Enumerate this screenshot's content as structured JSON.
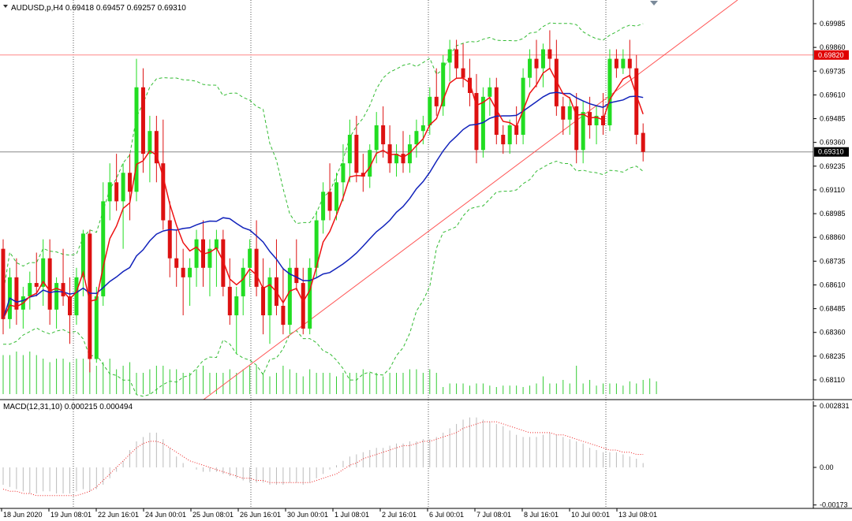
{
  "header": {
    "symbol_line": "AUDUSD,p,H4  0.69418 0.69457 0.69257 0.69310",
    "macd_line": "MACD(12,31,10) 0.000215 0.000494"
  },
  "colors": {
    "bull": "#22dd22",
    "bear": "#dd1111",
    "ma_fast": "#ee1111",
    "ma_slow": "#1122bb",
    "bollinger": "#33bb33",
    "trendline": "#ff5555",
    "resistance_line": "#ff8888",
    "support_line": "#888888",
    "grid_vertical": "#555555",
    "volume": "#33cc33",
    "macd_hist": "#bbbbbb",
    "macd_signal": "#ee2222",
    "label_red_bg": "#e00000",
    "label_black_bg": "#000000"
  },
  "price_axis": {
    "ticks": [
      "0.69985",
      "0.69860",
      "0.69735",
      "0.69610",
      "0.69485",
      "0.69360",
      "0.69235",
      "0.69110",
      "0.68985",
      "0.68860",
      "0.68735",
      "0.68610",
      "0.68485",
      "0.68360",
      "0.68235",
      "0.68110"
    ],
    "range": [
      0.6807,
      0.7002
    ]
  },
  "time_axis": {
    "ticks": [
      "18 Jun 2020",
      "19 Jun 08:01",
      "22 Jun 16:01",
      "24 Jun 00:01",
      "25 Jun 08:01",
      "26 Jun 16:01",
      "30 Jun 00:01",
      "1 Jul 08:01",
      "2 Jul 16:01",
      "6 Jul 00:01",
      "7 Jul 08:01",
      "8 Jul 16:01",
      "10 Jul 00:01",
      "13 Jul 08:01"
    ]
  },
  "horizontal_lines": {
    "resistance": "0.69820",
    "current": "0.69310"
  },
  "macd_axis": {
    "ticks": [
      "0.002831",
      "0.00",
      "-0.00173"
    ],
    "range": [
      -0.00173,
      0.002831
    ]
  },
  "chart_data": {
    "type": "candlestick",
    "symbol": "AUDUSD,p",
    "timeframe": "H4",
    "candles": [
      [
        0.688,
        0.6885,
        0.6835,
        0.6843
      ],
      [
        0.6843,
        0.687,
        0.6838,
        0.6865
      ],
      [
        0.6865,
        0.6875,
        0.684,
        0.6848
      ],
      [
        0.6848,
        0.686,
        0.6838,
        0.6855
      ],
      [
        0.6855,
        0.6868,
        0.6848,
        0.6862
      ],
      [
        0.6862,
        0.6878,
        0.6855,
        0.686
      ],
      [
        0.686,
        0.6885,
        0.685,
        0.6875
      ],
      [
        0.6875,
        0.6885,
        0.684,
        0.6848
      ],
      [
        0.6848,
        0.6865,
        0.6838,
        0.6862
      ],
      [
        0.6862,
        0.688,
        0.685,
        0.6855
      ],
      [
        0.6855,
        0.6865,
        0.683,
        0.6845
      ],
      [
        0.6845,
        0.687,
        0.684,
        0.6865
      ],
      [
        0.6865,
        0.689,
        0.6855,
        0.6888
      ],
      [
        0.6888,
        0.689,
        0.6815,
        0.6822
      ],
      [
        0.6822,
        0.686,
        0.682,
        0.6855
      ],
      [
        0.6855,
        0.6915,
        0.685,
        0.6905
      ],
      [
        0.6905,
        0.6925,
        0.6895,
        0.6915
      ],
      [
        0.6915,
        0.693,
        0.69,
        0.6905
      ],
      [
        0.6905,
        0.6925,
        0.688,
        0.692
      ],
      [
        0.692,
        0.693,
        0.6895,
        0.691
      ],
      [
        0.691,
        0.698,
        0.6905,
        0.6965
      ],
      [
        0.6965,
        0.6975,
        0.692,
        0.693
      ],
      [
        0.693,
        0.695,
        0.6915,
        0.6942
      ],
      [
        0.6942,
        0.695,
        0.6915,
        0.6925
      ],
      [
        0.6925,
        0.6948,
        0.689,
        0.6895
      ],
      [
        0.6895,
        0.6905,
        0.6865,
        0.6875
      ],
      [
        0.6875,
        0.689,
        0.686,
        0.687
      ],
      [
        0.687,
        0.688,
        0.6845,
        0.6865
      ],
      [
        0.6865,
        0.6875,
        0.685,
        0.687
      ],
      [
        0.687,
        0.689,
        0.686,
        0.6885
      ],
      [
        0.6885,
        0.6895,
        0.686,
        0.687
      ],
      [
        0.687,
        0.6885,
        0.6855,
        0.688
      ],
      [
        0.688,
        0.689,
        0.686,
        0.6885
      ],
      [
        0.6885,
        0.689,
        0.6855,
        0.686
      ],
      [
        0.686,
        0.6875,
        0.684,
        0.6845
      ],
      [
        0.6845,
        0.686,
        0.6825,
        0.6855
      ],
      [
        0.6855,
        0.6875,
        0.6845,
        0.687
      ],
      [
        0.687,
        0.6885,
        0.686,
        0.688
      ],
      [
        0.688,
        0.6895,
        0.6855,
        0.686
      ],
      [
        0.686,
        0.6875,
        0.6835,
        0.6845
      ],
      [
        0.6845,
        0.687,
        0.683,
        0.6865
      ],
      [
        0.6865,
        0.6885,
        0.6845,
        0.685
      ],
      [
        0.685,
        0.687,
        0.6835,
        0.684
      ],
      [
        0.684,
        0.6875,
        0.6835,
        0.687
      ],
      [
        0.687,
        0.6885,
        0.6858,
        0.6862
      ],
      [
        0.6862,
        0.687,
        0.6835,
        0.6838
      ],
      [
        0.6838,
        0.6875,
        0.6835,
        0.687
      ],
      [
        0.687,
        0.69,
        0.6865,
        0.6895
      ],
      [
        0.6895,
        0.6915,
        0.6888,
        0.691
      ],
      [
        0.691,
        0.6925,
        0.6895,
        0.69
      ],
      [
        0.69,
        0.692,
        0.6895,
        0.6915
      ],
      [
        0.6915,
        0.6935,
        0.6905,
        0.6925
      ],
      [
        0.6925,
        0.6948,
        0.6915,
        0.694
      ],
      [
        0.694,
        0.695,
        0.6915,
        0.692
      ],
      [
        0.692,
        0.693,
        0.691,
        0.6918
      ],
      [
        0.6918,
        0.6935,
        0.6912,
        0.6932
      ],
      [
        0.6932,
        0.6952,
        0.6925,
        0.6945
      ],
      [
        0.6945,
        0.6955,
        0.6928,
        0.6935
      ],
      [
        0.6935,
        0.6945,
        0.692,
        0.6925
      ],
      [
        0.6925,
        0.6935,
        0.6918,
        0.693
      ],
      [
        0.693,
        0.6942,
        0.692,
        0.6925
      ],
      [
        0.6925,
        0.694,
        0.692,
        0.6935
      ],
      [
        0.6935,
        0.6948,
        0.6928,
        0.6942
      ],
      [
        0.6942,
        0.695,
        0.6935,
        0.6945
      ],
      [
        0.6945,
        0.6965,
        0.694,
        0.696
      ],
      [
        0.696,
        0.6975,
        0.695,
        0.6955
      ],
      [
        0.6955,
        0.6982,
        0.695,
        0.6978
      ],
      [
        0.6978,
        0.699,
        0.6968,
        0.6985
      ],
      [
        0.6985,
        0.699,
        0.697,
        0.6975
      ],
      [
        0.6975,
        0.6988,
        0.6965,
        0.697
      ],
      [
        0.697,
        0.698,
        0.6955,
        0.6962
      ],
      [
        0.6962,
        0.6972,
        0.6925,
        0.6932
      ],
      [
        0.6932,
        0.6965,
        0.6928,
        0.696
      ],
      [
        0.696,
        0.697,
        0.695,
        0.6965
      ],
      [
        0.6965,
        0.697,
        0.6935,
        0.694
      ],
      [
        0.694,
        0.6945,
        0.693,
        0.6935
      ],
      [
        0.6935,
        0.6948,
        0.693,
        0.6945
      ],
      [
        0.6945,
        0.6955,
        0.6935,
        0.694
      ],
      [
        0.694,
        0.6975,
        0.6935,
        0.697
      ],
      [
        0.697,
        0.6985,
        0.6965,
        0.698
      ],
      [
        0.698,
        0.699,
        0.6965,
        0.6975
      ],
      [
        0.6975,
        0.6988,
        0.6965,
        0.6985
      ],
      [
        0.6985,
        0.6995,
        0.6975,
        0.698
      ],
      [
        0.698,
        0.699,
        0.695,
        0.6955
      ],
      [
        0.6955,
        0.696,
        0.694,
        0.6948
      ],
      [
        0.6948,
        0.696,
        0.694,
        0.6955
      ],
      [
        0.6955,
        0.6962,
        0.6925,
        0.6932
      ],
      [
        0.6932,
        0.6958,
        0.6925,
        0.6952
      ],
      [
        0.6952,
        0.696,
        0.6938,
        0.6945
      ],
      [
        0.6945,
        0.6955,
        0.6935,
        0.695
      ],
      [
        0.695,
        0.6962,
        0.694,
        0.6945
      ],
      [
        0.6945,
        0.6985,
        0.6942,
        0.698
      ],
      [
        0.698,
        0.6985,
        0.697,
        0.6975
      ],
      [
        0.6975,
        0.6985,
        0.6972,
        0.698
      ],
      [
        0.698,
        0.699,
        0.697,
        0.6975
      ],
      [
        0.6975,
        0.6982,
        0.6935,
        0.694
      ],
      [
        0.6941,
        0.6946,
        0.6926,
        0.6931
      ]
    ],
    "volume": [
      0.55,
      0.55,
      0.6,
      0.55,
      0.6,
      0.55,
      0.5,
      0.45,
      0.5,
      0.5,
      0.45,
      0.5,
      0.5,
      0.45,
      0.4,
      0.45,
      0.5,
      0.35,
      0.4,
      0.45,
      0.3,
      0.3,
      0.35,
      0.4,
      0.4,
      0.35,
      0.35,
      0.3,
      0.3,
      0.35,
      0.4,
      0.3,
      0.3,
      0.3,
      0.35,
      0.3,
      0.35,
      0.4,
      0.4,
      0.3,
      0.25,
      0.3,
      0.4,
      0.35,
      0.3,
      0.25,
      0.35,
      0.3,
      0.3,
      0.3,
      0.25,
      0.3,
      0.3,
      0.3,
      0.35,
      0.3,
      0.3,
      0.25,
      0.3,
      0.3,
      0.3,
      0.35,
      0.35,
      0.3,
      0.35,
      0.3,
      0.1,
      0.15,
      0.15,
      0.15,
      0.12,
      0.15,
      0.15,
      0.12,
      0.1,
      0.12,
      0.12,
      0.12,
      0.1,
      0.12,
      0.15,
      0.25,
      0.15,
      0.15,
      0.2,
      0.15,
      0.4,
      0.15,
      0.2,
      0.12,
      0.15,
      0.15,
      0.15,
      0.12,
      0.18,
      0.15,
      0.2,
      0.22,
      0.18
    ],
    "macd_hist": [
      -0.0008,
      -0.0009,
      -0.001,
      -0.0011,
      -0.0012,
      -0.0012,
      -0.0011,
      -0.0011,
      -0.0012,
      -0.0012,
      -0.0012,
      -0.0011,
      -0.001,
      -0.0011,
      -0.001,
      -0.0008,
      -0.0005,
      -0.0002,
      0.0003,
      0.0008,
      0.0012,
      0.0014,
      0.0016,
      0.0016,
      0.0013,
      0.0009,
      0.0005,
      0.0002,
      0.0,
      -0.0001,
      -0.0002,
      -0.0002,
      -0.0002,
      -0.0003,
      -0.0004,
      -0.0005,
      -0.0006,
      -0.0007,
      -0.0007,
      -0.0007,
      -0.0008,
      -0.0008,
      -0.0008,
      -0.0007,
      -0.0007,
      -0.0008,
      -0.0007,
      -0.0005,
      -0.0003,
      -0.0001,
      0.0001,
      0.0003,
      0.0005,
      0.0006,
      0.0007,
      0.0008,
      0.0009,
      0.0009,
      0.001,
      0.0011,
      0.0011,
      0.0012,
      0.0012,
      0.0013,
      0.0013,
      0.0014,
      0.0016,
      0.0018,
      0.002,
      0.0022,
      0.0023,
      0.0023,
      0.0022,
      0.0021,
      0.002,
      0.0019,
      0.0017,
      0.0015,
      0.0014,
      0.0014,
      0.0014,
      0.0015,
      0.0016,
      0.0015,
      0.0014,
      0.0013,
      0.0012,
      0.0011,
      0.0009,
      0.0008,
      0.0007,
      0.0007,
      0.0007,
      0.0006,
      0.0005,
      0.0004,
      0.0002
    ],
    "macd_signal": [
      -0.001,
      -0.0011,
      -0.0011,
      -0.0012,
      -0.0012,
      -0.0013,
      -0.0013,
      -0.0013,
      -0.0013,
      -0.0013,
      -0.0013,
      -0.0013,
      -0.0012,
      -0.0011,
      -0.0009,
      -0.0006,
      -0.0003,
      0.0,
      0.0003,
      0.0006,
      0.0009,
      0.0011,
      0.0012,
      0.0012,
      0.0011,
      0.0009,
      0.0007,
      0.0005,
      0.0003,
      0.0002,
      0.0001,
      0.0,
      -0.0001,
      -0.0002,
      -0.0003,
      -0.0004,
      -0.0005,
      -0.0005,
      -0.0006,
      -0.0006,
      -0.0007,
      -0.0007,
      -0.0007,
      -0.0007,
      -0.0007,
      -0.0007,
      -0.0007,
      -0.0006,
      -0.0005,
      -0.0004,
      -0.0003,
      -0.0001,
      0.0001,
      0.0002,
      0.0004,
      0.0005,
      0.0006,
      0.0007,
      0.0008,
      0.0009,
      0.001,
      0.001,
      0.0011,
      0.0012,
      0.0012,
      0.0013,
      0.0014,
      0.0015,
      0.0016,
      0.0018,
      0.0019,
      0.002,
      0.0021,
      0.0021,
      0.0021,
      0.002,
      0.0019,
      0.0018,
      0.0017,
      0.0016,
      0.0016,
      0.0016,
      0.0016,
      0.0015,
      0.0015,
      0.0014,
      0.0013,
      0.0012,
      0.0011,
      0.001,
      0.0009,
      0.0008,
      0.0008,
      0.0007,
      0.0007,
      0.0006,
      0.0006
    ]
  }
}
